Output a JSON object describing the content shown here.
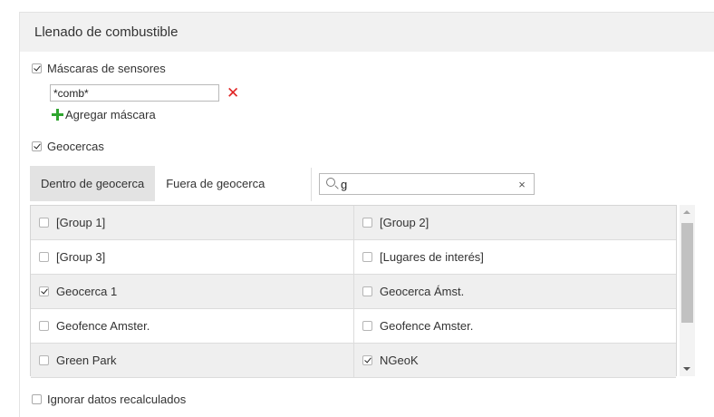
{
  "panel": {
    "title": "Llenado de combustible"
  },
  "sensor_masks": {
    "label": "Máscaras de sensores",
    "checked": true,
    "mask_value": "*comb*",
    "add_label": "Agregar máscara"
  },
  "geofences": {
    "label": "Geocercas",
    "checked": true,
    "tabs": [
      {
        "label": "Dentro de geocerca",
        "active": true
      },
      {
        "label": "Fuera de geocerca",
        "active": false
      }
    ],
    "search_value": "g",
    "search_clear": "×",
    "rows": [
      [
        {
          "label": "[Group 1]",
          "checked": false
        },
        {
          "label": "[Group 2]",
          "checked": false
        }
      ],
      [
        {
          "label": "[Group 3]",
          "checked": false
        },
        {
          "label": "[Lugares de interés]",
          "checked": false
        }
      ],
      [
        {
          "label": "Geocerca 1",
          "checked": true
        },
        {
          "label": "Geocerca Ámst.",
          "checked": false
        }
      ],
      [
        {
          "label": "Geofence Amster.",
          "checked": false
        },
        {
          "label": "Geofence Amster.",
          "checked": false
        }
      ],
      [
        {
          "label": "Green Park",
          "checked": false
        },
        {
          "label": "NGeoK",
          "checked": true
        }
      ]
    ]
  },
  "ignore_recalculated": {
    "label": "Ignorar datos recalculados",
    "checked": false
  },
  "colors": {
    "header_bg": "#f1f1f1",
    "active_tab_bg": "#e3e3e3",
    "remove_red": "#e02424",
    "add_green": "#2fa52f"
  }
}
